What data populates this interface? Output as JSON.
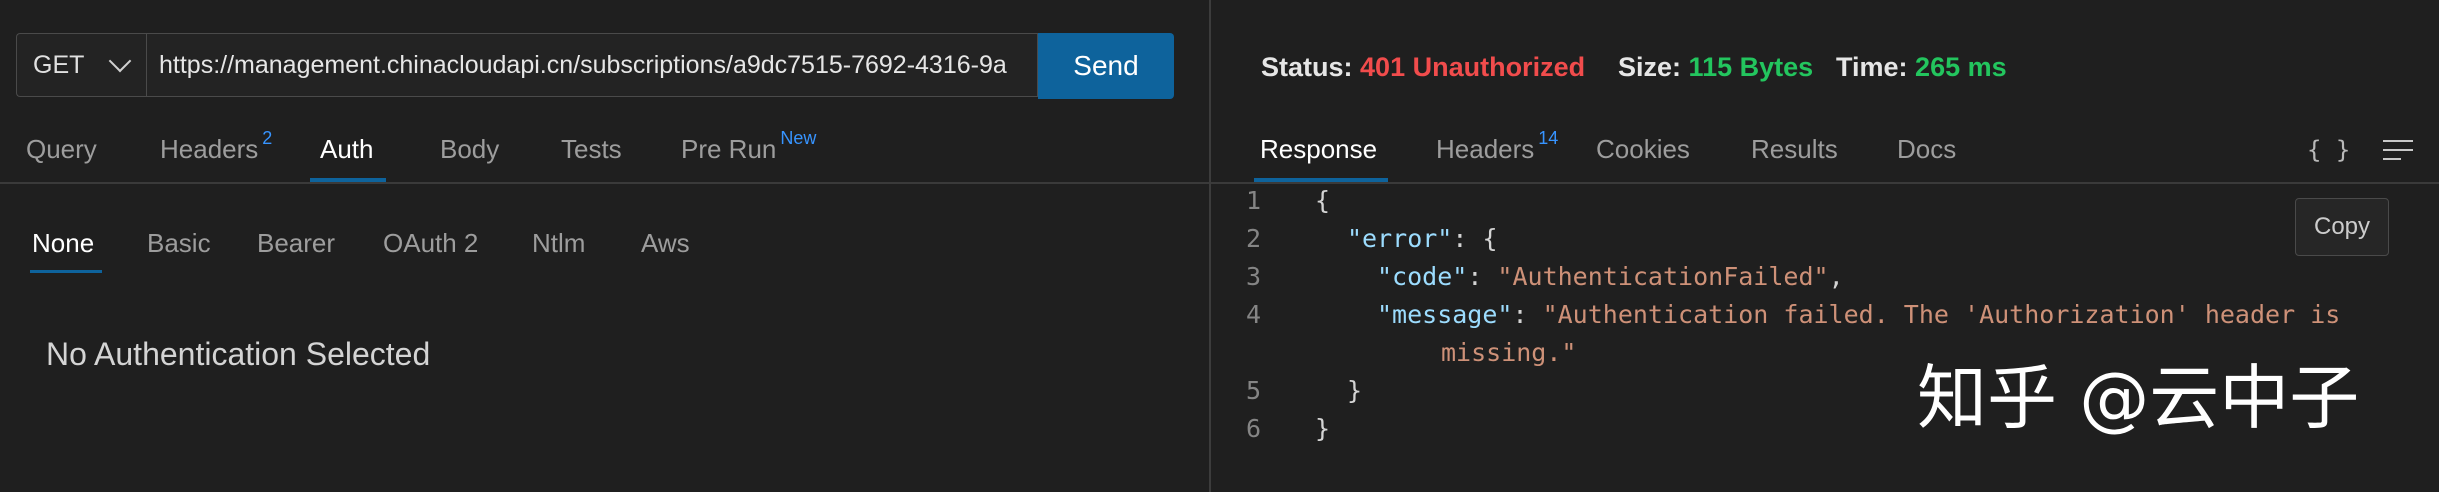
{
  "request": {
    "method": "GET",
    "url": "https://management.chinacloudapi.cn/subscriptions/a9dc7515-7692-4316-9a",
    "send_label": "Send"
  },
  "request_tabs": [
    {
      "label": "Query",
      "badge": ""
    },
    {
      "label": "Headers",
      "badge": "2"
    },
    {
      "label": "Auth",
      "badge": "",
      "active": true
    },
    {
      "label": "Body",
      "badge": ""
    },
    {
      "label": "Tests",
      "badge": ""
    },
    {
      "label": "Pre Run",
      "badge": "New"
    }
  ],
  "auth_tabs": [
    {
      "label": "None",
      "active": true
    },
    {
      "label": "Basic"
    },
    {
      "label": "Bearer"
    },
    {
      "label": "OAuth 2"
    },
    {
      "label": "Ntlm"
    },
    {
      "label": "Aws"
    }
  ],
  "auth_message": "No Authentication Selected",
  "response_status": {
    "status_label": "Status:",
    "status_value": "401 Unauthorized",
    "size_label": "Size:",
    "size_value": "115 Bytes",
    "time_label": "Time:",
    "time_value": "265 ms"
  },
  "response_tabs": [
    {
      "label": "Response",
      "badge": "",
      "active": true
    },
    {
      "label": "Headers",
      "badge": "14"
    },
    {
      "label": "Cookies",
      "badge": ""
    },
    {
      "label": "Results",
      "badge": ""
    },
    {
      "label": "Docs",
      "badge": ""
    }
  ],
  "toolbar": {
    "braces": "{ }",
    "wrap_icon": "wrap-lines-icon"
  },
  "copy_label": "Copy",
  "code_lines": {
    "l1": {
      "num": "1",
      "open": "{"
    },
    "l2": {
      "num": "2",
      "key": "\"error\"",
      "rest": ": {"
    },
    "l3": {
      "num": "3",
      "key": "\"code\"",
      "sep": ": ",
      "val": "\"AuthenticationFailed\"",
      "end": ","
    },
    "l4": {
      "num": "4",
      "key": "\"message\"",
      "sep": ": ",
      "val": "\"Authentication failed. The 'Authorization' header is"
    },
    "l4b": {
      "val": "missing.\""
    },
    "l5": {
      "num": "5",
      "close": "}"
    },
    "l6": {
      "num": "6",
      "close": "}"
    }
  },
  "watermark": "知乎 @云中子",
  "colors": {
    "accent": "#0e639c",
    "error": "#f14c4c",
    "success": "#23c55e",
    "badge": "#3794ff"
  }
}
